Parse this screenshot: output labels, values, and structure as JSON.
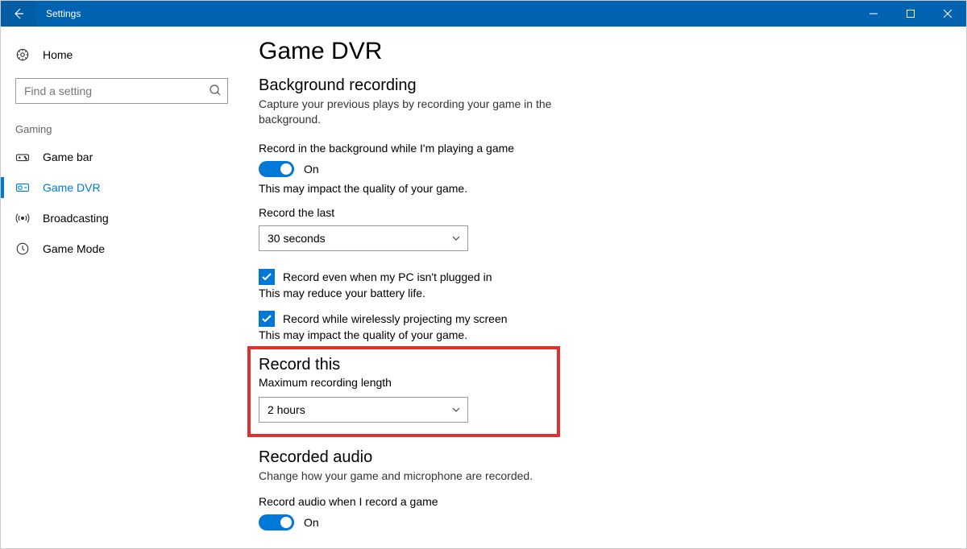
{
  "titlebar": {
    "title": "Settings"
  },
  "sidebar": {
    "home": "Home",
    "search_placeholder": "Find a setting",
    "section_label": "Gaming",
    "items": [
      {
        "label": "Game bar"
      },
      {
        "label": "Game DVR"
      },
      {
        "label": "Broadcasting"
      },
      {
        "label": "Game Mode"
      }
    ]
  },
  "main": {
    "page_title": "Game DVR",
    "bg_heading": "Background recording",
    "bg_desc": "Capture your previous plays by recording your game in the background.",
    "bg_toggle_label": "Record in the background while I'm playing a game",
    "bg_toggle_state": "On",
    "bg_quality_hint": "This may impact the quality of your game.",
    "record_last_label": "Record the last",
    "record_last_value": "30 seconds",
    "cb_plugged_label": "Record even when my PC isn't plugged in",
    "cb_plugged_hint": "This may reduce your battery life.",
    "cb_project_label": "Record while wirelessly projecting my screen",
    "cb_project_hint": "This may impact the quality of your game.",
    "record_this_heading": "Record this",
    "max_len_label": "Maximum recording length",
    "max_len_value": "2 hours",
    "audio_heading": "Recorded audio",
    "audio_desc": "Change how your game and microphone are recorded.",
    "audio_toggle_label": "Record audio when I record a game",
    "audio_toggle_state": "On"
  }
}
